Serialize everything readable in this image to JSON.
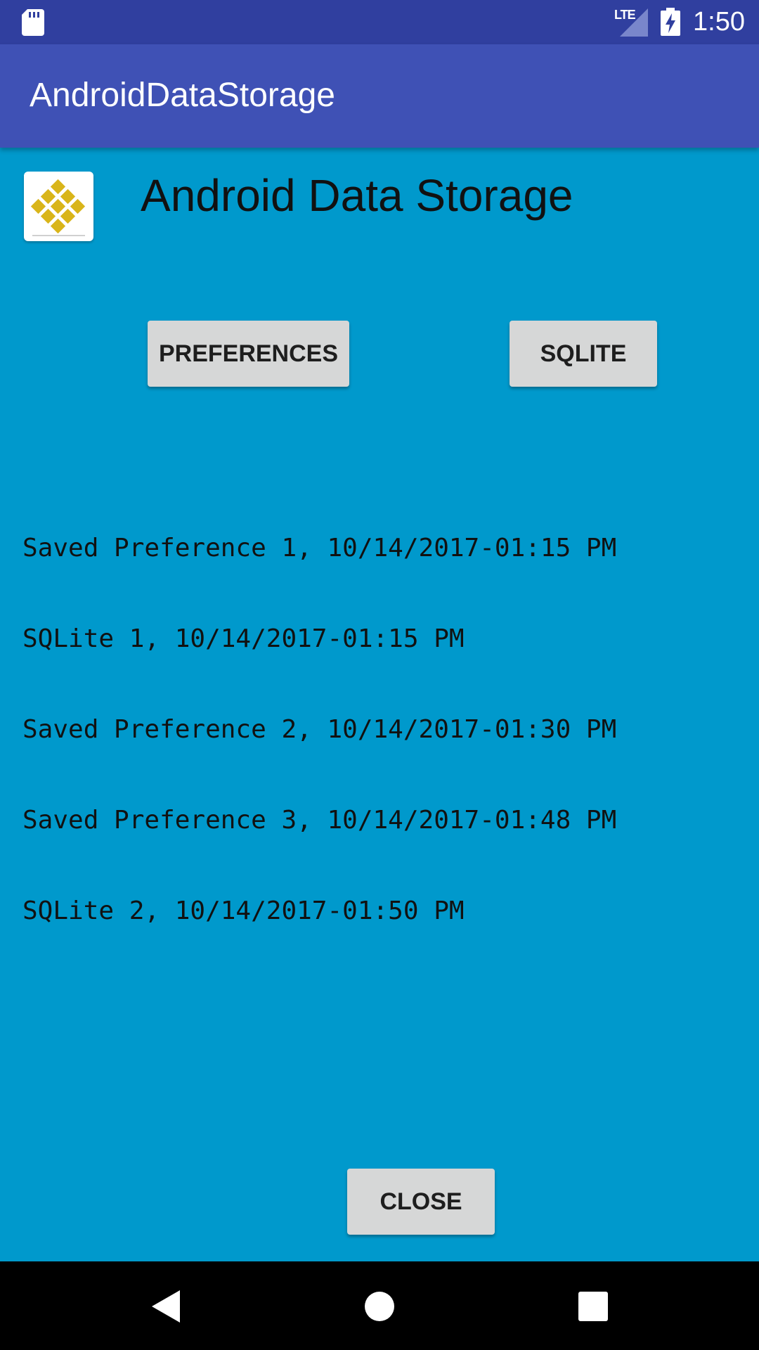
{
  "status_bar": {
    "time": "1:50",
    "network": "LTE",
    "icons": [
      "sd-card-icon",
      "lte-signal-icon",
      "battery-charging-icon"
    ]
  },
  "app_bar": {
    "title": "AndroidDataStorage"
  },
  "header": {
    "logo_icon": "app-logo-icon",
    "title": "Android Data Storage"
  },
  "actions": {
    "preferences_label": "PREFERENCES",
    "sqlite_label": "SQLITE"
  },
  "log": {
    "entries": [
      "Saved Preference 1, 10/14/2017-01:15 PM",
      "SQLite 1, 10/14/2017-01:15 PM",
      "Saved Preference 2, 10/14/2017-01:30 PM",
      "Saved Preference 3, 10/14/2017-01:48 PM",
      "SQLite 2, 10/14/2017-01:50 PM"
    ]
  },
  "footer": {
    "close_label": "CLOSE"
  },
  "nav_bar": {
    "icons": [
      "back-icon",
      "home-icon",
      "recents-icon"
    ]
  },
  "colors": {
    "status_bar": "#303f9f",
    "app_bar": "#3f51b5",
    "background": "#0099cc",
    "button": "#d6d7d7",
    "logo_gold": "#d9b51a"
  }
}
